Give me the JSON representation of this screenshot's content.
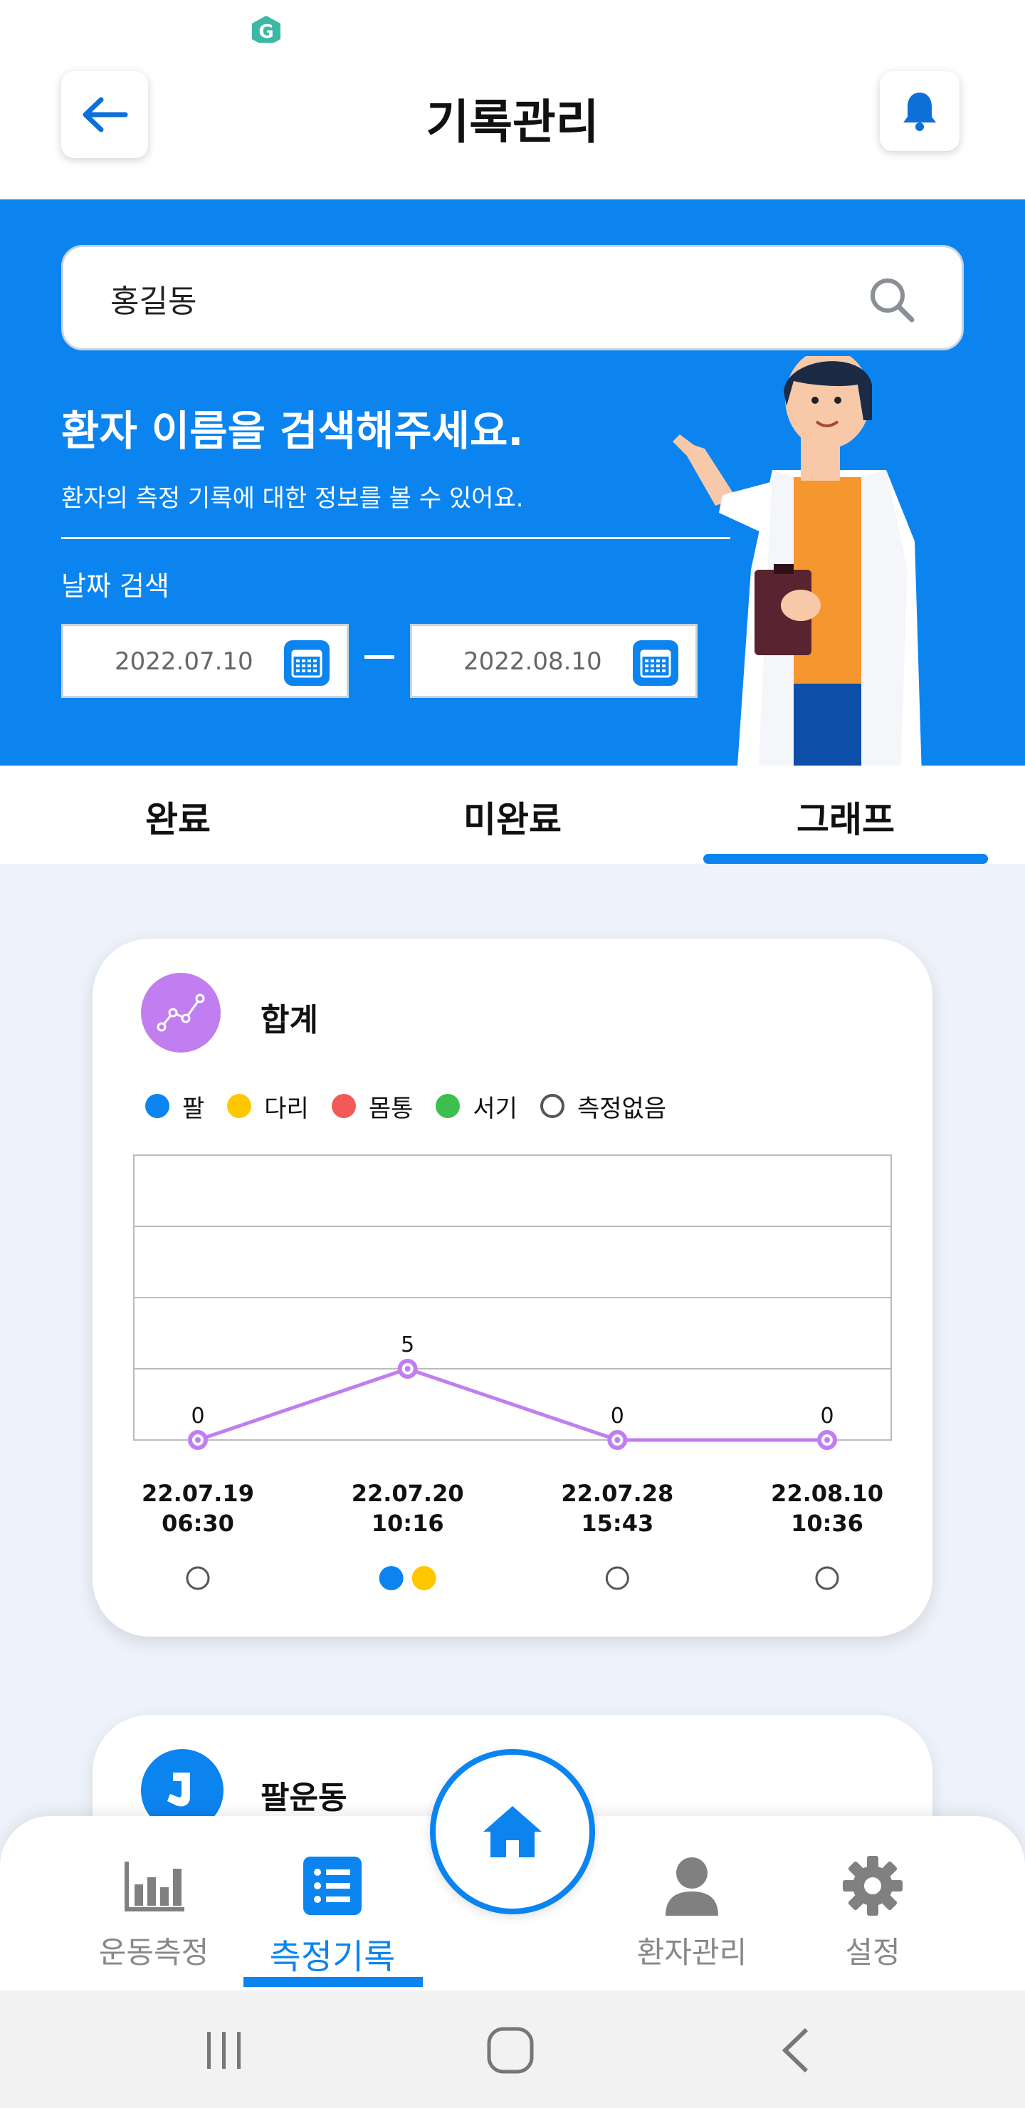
{
  "header": {
    "title": "기록관리",
    "back_icon": "arrow-left-icon",
    "notification_icon": "bell-icon"
  },
  "search": {
    "value": "홍길동",
    "icon": "search-icon"
  },
  "hero": {
    "heading": "환자 이름을 검색해주세요.",
    "subtext": "환자의 측정 기록에 대한 정보를 볼 수 있어요.",
    "date_label": "날짜 검색",
    "date_start": "2022.07.10",
    "date_end": "2022.08.10"
  },
  "tabs": [
    {
      "label": "완료",
      "active": false
    },
    {
      "label": "미완료",
      "active": false
    },
    {
      "label": "그래프",
      "active": true
    }
  ],
  "summary_card": {
    "title": "합계",
    "icon": "line-chart-icon",
    "legend": [
      {
        "label": "팔",
        "color": "#0b84f0"
      },
      {
        "label": "다리",
        "color": "#ffc700"
      },
      {
        "label": "몸통",
        "color": "#f25a5a"
      },
      {
        "label": "서기",
        "color": "#3cbf4f"
      },
      {
        "label": "측정없음",
        "color": "none"
      }
    ]
  },
  "chart_data": {
    "type": "line",
    "title": "",
    "series": [
      {
        "values": [
          0,
          5,
          0,
          0
        ],
        "color": "#c07ef0"
      }
    ],
    "categories": [
      {
        "date": "22.07.19",
        "time": "06:30",
        "markers": [
          "none"
        ]
      },
      {
        "date": "22.07.20",
        "time": "10:16",
        "markers": [
          "#0b84f0",
          "#ffc700"
        ]
      },
      {
        "date": "22.07.28",
        "time": "15:43",
        "markers": [
          "none"
        ]
      },
      {
        "date": "22.08.10",
        "time": "10:36",
        "markers": [
          "none"
        ]
      }
    ],
    "ylim": [
      0,
      20
    ],
    "grid": true
  },
  "second_card": {
    "title": "팔운동",
    "icon": "arm-icon"
  },
  "bottom_nav": [
    {
      "label": "운동측정",
      "icon": "bar-chart-icon",
      "active": false
    },
    {
      "label": "측정기록",
      "icon": "list-icon",
      "active": true
    },
    {
      "label": "환자관리",
      "icon": "person-icon",
      "active": false
    },
    {
      "label": "설정",
      "icon": "gear-icon",
      "active": false
    }
  ],
  "home_icon": "home-icon",
  "colors": {
    "primary": "#0b84f0",
    "line": "#c07ef0"
  }
}
